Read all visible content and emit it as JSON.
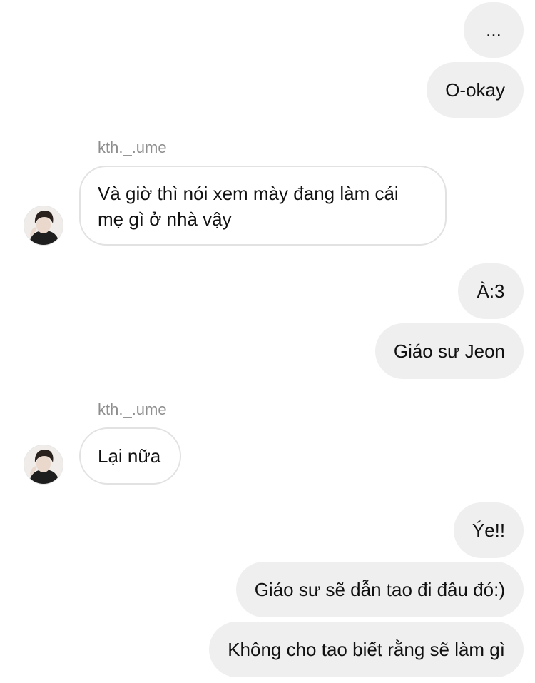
{
  "messages": {
    "m1": "...",
    "m2": "O-okay",
    "sender1": "kth._.ume",
    "m3": "Và giờ thì nói xem mày đang làm cái mẹ gì ở nhà vậy",
    "m4": "À:3",
    "m5": "Giáo sư Jeon",
    "sender2": "kth._.ume",
    "m6": "Lại nữa",
    "m7": "Ýe!!",
    "m8": "Giáo sư sẽ dẫn tao đi đâu đó:)",
    "m9": "Không cho tao biết rằng sẽ làm gì"
  },
  "colors": {
    "outgoing_bubble": "#efefef",
    "incoming_border": "#e2e2e2",
    "sender_text": "#8e8e8e"
  },
  "icons": {
    "avatar": "profile-photo-avatar"
  }
}
